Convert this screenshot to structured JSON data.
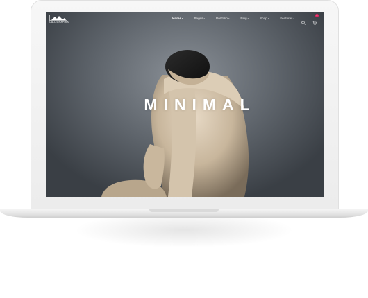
{
  "site": {
    "logo_text": "CALLIGRAPHIA"
  },
  "nav": {
    "items": [
      {
        "label": "Home",
        "active": true
      },
      {
        "label": "Pages"
      },
      {
        "label": "Portfolio"
      },
      {
        "label": "Blog"
      },
      {
        "label": "Shop"
      },
      {
        "label": "Features"
      }
    ],
    "cart_count": "0"
  },
  "hero": {
    "title": "MINIMAL"
  },
  "colors": {
    "accent": "#e0245e",
    "background": "#5e646b"
  },
  "icons": [
    "logo-mountain-icon",
    "search-icon",
    "cart-icon"
  ]
}
